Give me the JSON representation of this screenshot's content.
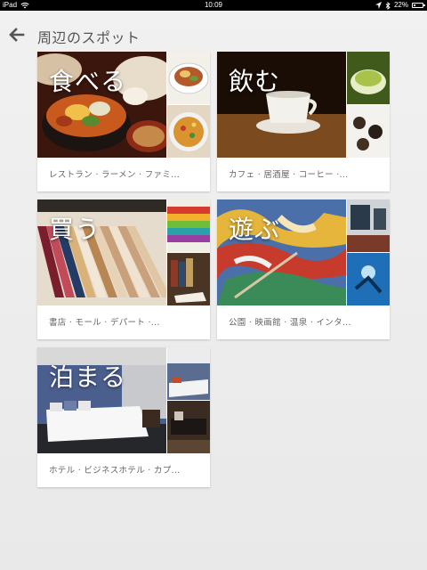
{
  "status_bar": {
    "device": "iPad",
    "time": "10:09",
    "battery": "22%",
    "battery_level": 0.22
  },
  "header": {
    "title": "周辺のスポット"
  },
  "categories": [
    {
      "title": "食べる",
      "subtitle": "レストラン · ラーメン · ファミ..."
    },
    {
      "title": "飲む",
      "subtitle": "カフェ · 居酒屋 · コーヒー ·..."
    },
    {
      "title": "買う",
      "subtitle": "書店 · モール · デパート ·..."
    },
    {
      "title": "遊ぶ",
      "subtitle": "公園 · 映画館 · 温泉 · インタ..."
    },
    {
      "title": "泊まる",
      "subtitle": "ホテル · ビジネスホテル · カプ..."
    }
  ],
  "colors": {
    "background": "#eeeeee",
    "card": "#ffffff",
    "title_text": "#555555",
    "subtitle_text": "#666666"
  },
  "icons": {
    "back": "arrow-left-icon",
    "wifi": "wifi-icon",
    "location": "location-icon",
    "bluetooth": "bluetooth-icon",
    "battery": "battery-icon"
  }
}
